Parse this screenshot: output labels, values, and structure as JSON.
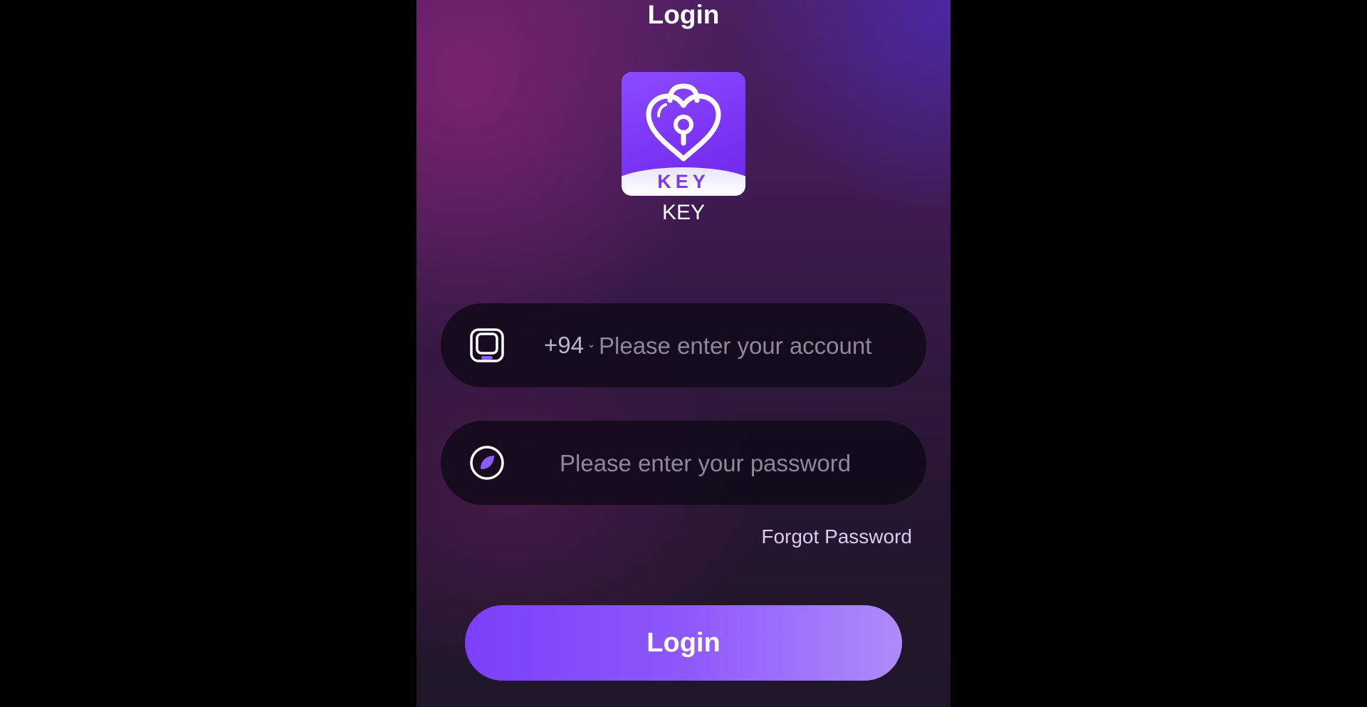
{
  "header": {
    "title": "Login"
  },
  "app": {
    "logo_text": "KEY",
    "name": "KEY"
  },
  "account": {
    "country_code": "+94",
    "placeholder": "Please enter your account",
    "value": "",
    "icon": "phone-icon"
  },
  "password": {
    "placeholder": "Please enter your password",
    "value": "",
    "icon": "leaf-icon"
  },
  "links": {
    "forgot_password": "Forgot Password"
  },
  "actions": {
    "login_label": "Login"
  },
  "colors": {
    "accent": "#7b3ff8",
    "accent_light": "#ae8cfb"
  }
}
